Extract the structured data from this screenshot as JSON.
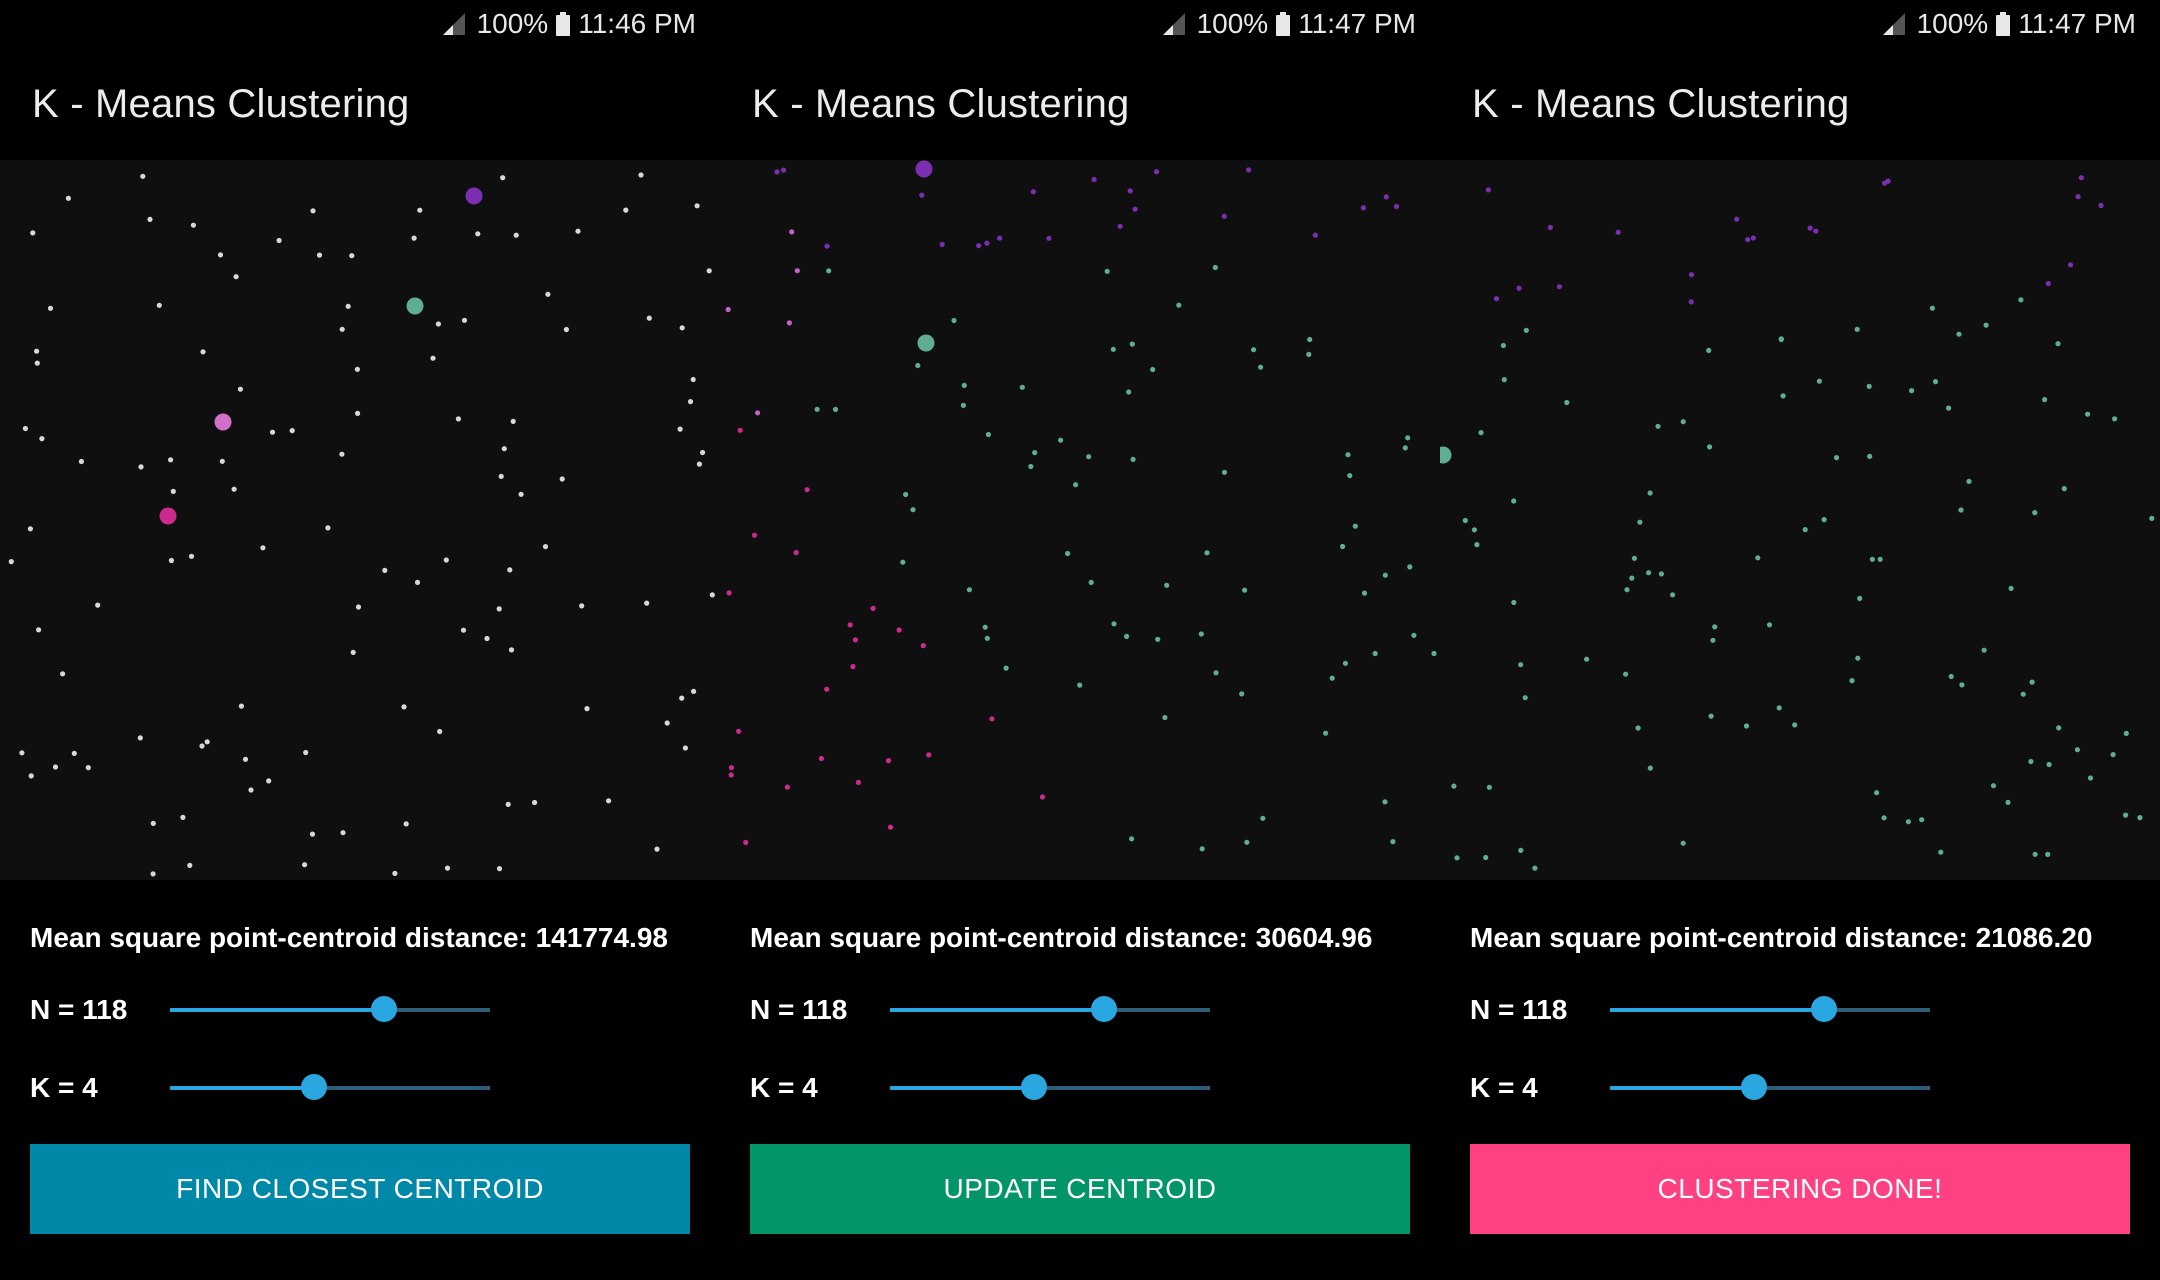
{
  "screens": [
    {
      "status": {
        "battery_percent": "100%",
        "time": "11:46 PM"
      },
      "title": "K - Means Clustering",
      "mean_square_label": "Mean square point-centroid distance: 141774.98",
      "n_label": "N = 118",
      "n_slider_value": 0.67,
      "k_label": "K = 4",
      "k_slider_value": 0.45,
      "button_label": "FIND CLOSEST CENTROID",
      "button_color": "#0088a8",
      "point_mode": "unassigned"
    },
    {
      "status": {
        "battery_percent": "100%",
        "time": "11:47 PM"
      },
      "title": "K - Means Clustering",
      "mean_square_label": "Mean square point-centroid distance: 30604.96",
      "n_label": "N = 118",
      "n_slider_value": 0.67,
      "k_label": "K = 4",
      "k_slider_value": 0.45,
      "button_label": "UPDATE CENTROID",
      "button_color": "#03956a",
      "point_mode": "clustered"
    },
    {
      "status": {
        "battery_percent": "100%",
        "time": "11:47 PM"
      },
      "title": "K - Means Clustering",
      "mean_square_label": "Mean square point-centroid distance: 21086.20",
      "n_label": "N = 118",
      "n_slider_value": 0.67,
      "k_label": "K = 4",
      "k_slider_value": 0.45,
      "button_label": "CLUSTERING DONE!",
      "button_color": "#ff4081",
      "point_mode": "clustered"
    }
  ],
  "colors": {
    "cluster_colors": [
      "#c560c6",
      "#7b2fb0",
      "#5fad95",
      "#cc2a8e"
    ],
    "unassigned_point": "#d8d8d8",
    "slider_accent": "#2aa7e0"
  }
}
